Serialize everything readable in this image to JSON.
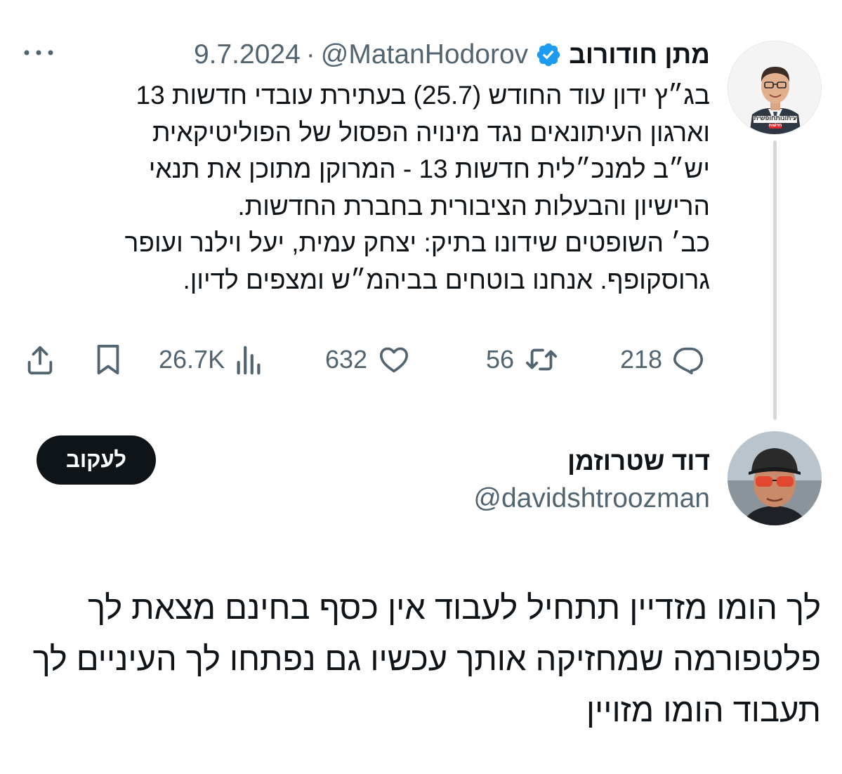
{
  "original_tweet": {
    "author_name": "מתן חודורוב",
    "verified": true,
    "handle": "@MatanHodorov",
    "separator": "·",
    "date": "9.7.2024",
    "avatar_badge_text": "עיתונותחופשית",
    "avatar_badge_sub": "חדשות",
    "body_lines": [
      "בג״ץ ידון עוד החודש (25.7) בעתירת עובדי חדשות 13",
      "וארגון העיתונאים נגד מינויה הפסול של הפוליטיקאית",
      "יש״ב למנכ״לית חדשות 13 - המרוקן מתוכן את תנאי",
      "הרישיון והבעלות הציבורית בחברת החדשות.",
      "כב׳ השופטים שידונו בתיק: יצחק עמית, יעל וילנר ועופר",
      "גרוסקופף. אנחנו בוטחים בביהמ״ש ומצפים לדיון."
    ],
    "actions": {
      "replies": "218",
      "retweets": "56",
      "likes": "632",
      "views": "26.7K"
    },
    "icons": {
      "more": "more-dots-icon",
      "reply": "reply-icon",
      "retweet": "retweet-icon",
      "like": "heart-icon",
      "views": "views-icon",
      "bookmark": "bookmark-icon",
      "share": "share-icon",
      "verified": "verified-badge-icon"
    }
  },
  "reply_tweet": {
    "author_name": "דוד שטרוזמן",
    "handle": "@davidshtroozman",
    "follow_label": "לעקוב",
    "body_lines": [
      "לך הומו מזדיין תתחיל לעבוד אין כסף בחינם מצאת לך",
      "פלטפורמה שמחזיקה אותך עכשיו גם נפתחו לך העיניים לך",
      "תעבוד הומו מזויין"
    ]
  },
  "colors": {
    "text_primary": "#0f1419",
    "text_secondary": "#536471",
    "verified_blue": "#1d9bf0",
    "thread_line": "#cfd9de",
    "follow_button_bg": "#0f1419",
    "badge_red": "#e0282d"
  }
}
